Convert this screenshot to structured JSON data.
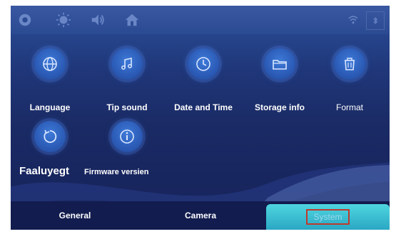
{
  "topbar": {
    "icons": [
      "settings-gear-icon",
      "brightness-icon",
      "volume-icon",
      "home-icon"
    ],
    "right_icons": [
      "wifi-icon",
      "bluetooth-icon"
    ]
  },
  "tiles": [
    {
      "label": "Language",
      "icon": "globe-icon"
    },
    {
      "label": "Tip sound",
      "icon": "music-note-icon"
    },
    {
      "label": "Date and Time",
      "icon": "clock-icon"
    },
    {
      "label": "Storage info",
      "icon": "folder-icon"
    },
    {
      "label": "Format",
      "icon": "trash-icon"
    },
    {
      "label": "",
      "icon": "reset-icon"
    },
    {
      "label": "",
      "icon": "info-icon"
    }
  ],
  "lower_labels": {
    "reset": "Faaluyegt",
    "firmware": "Firmware versien"
  },
  "tabs": [
    {
      "label": "General"
    },
    {
      "label": "Camera"
    },
    {
      "label": "System"
    }
  ],
  "colors": {
    "accent": "#2aa7c4",
    "highlight_border": "#c0392b"
  }
}
